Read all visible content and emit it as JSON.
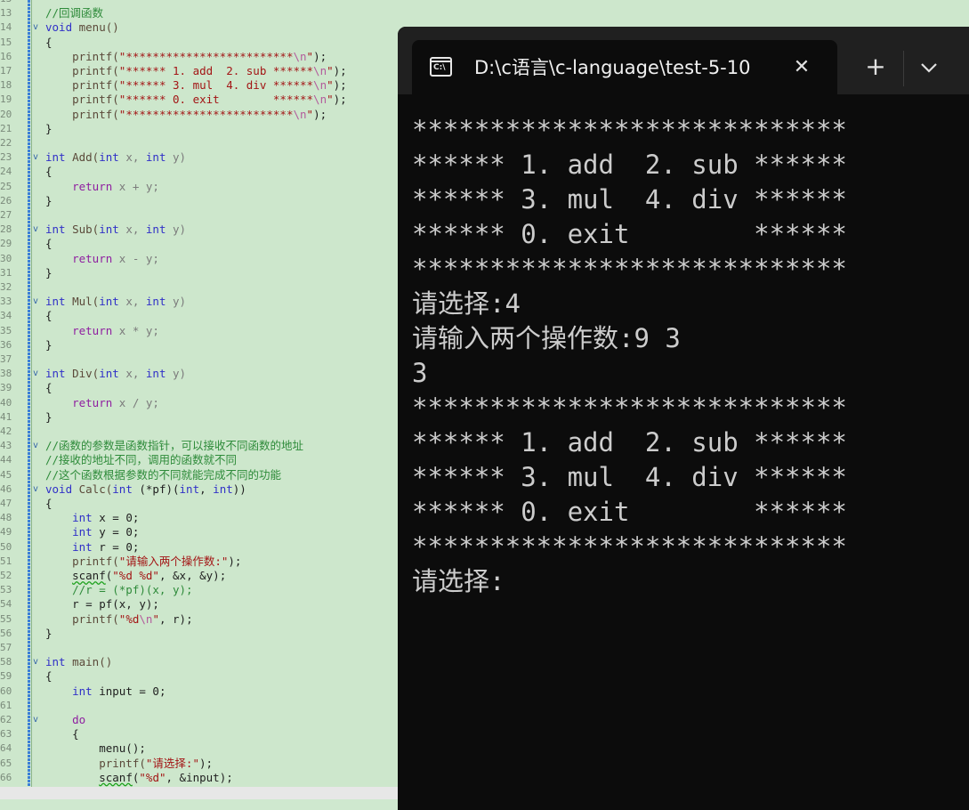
{
  "editor": {
    "lines": [
      {
        "n": "13",
        "fold": "",
        "tokens": [
          {
            "t": "",
            "c": "x"
          }
        ]
      },
      {
        "n": "13",
        "fold": "",
        "tokens": [
          {
            "t": "//回调函数",
            "c": "cm"
          }
        ]
      },
      {
        "n": "14",
        "fold": "v",
        "tokens": [
          {
            "t": "void",
            "c": "kw"
          },
          {
            "t": " menu()",
            "c": "fn"
          }
        ]
      },
      {
        "n": "15",
        "fold": "",
        "tokens": [
          {
            "t": "{",
            "c": "x"
          }
        ]
      },
      {
        "n": "16",
        "fold": "",
        "tokens": [
          {
            "t": "    printf(",
            "c": "fn"
          },
          {
            "t": "\"*************************",
            "c": "str"
          },
          {
            "t": "\\n",
            "c": "esc"
          },
          {
            "t": "\"",
            "c": "str"
          },
          {
            "t": ");",
            "c": "x"
          }
        ]
      },
      {
        "n": "17",
        "fold": "",
        "tokens": [
          {
            "t": "    printf(",
            "c": "fn"
          },
          {
            "t": "\"****** 1. add  2. sub ******",
            "c": "str"
          },
          {
            "t": "\\n",
            "c": "esc"
          },
          {
            "t": "\"",
            "c": "str"
          },
          {
            "t": ");",
            "c": "x"
          }
        ]
      },
      {
        "n": "18",
        "fold": "",
        "tokens": [
          {
            "t": "    printf(",
            "c": "fn"
          },
          {
            "t": "\"****** 3. mul  4. div ******",
            "c": "str"
          },
          {
            "t": "\\n",
            "c": "esc"
          },
          {
            "t": "\"",
            "c": "str"
          },
          {
            "t": ");",
            "c": "x"
          }
        ]
      },
      {
        "n": "19",
        "fold": "",
        "tokens": [
          {
            "t": "    printf(",
            "c": "fn"
          },
          {
            "t": "\"****** 0. exit        ******",
            "c": "str"
          },
          {
            "t": "\\n",
            "c": "esc"
          },
          {
            "t": "\"",
            "c": "str"
          },
          {
            "t": ");",
            "c": "x"
          }
        ]
      },
      {
        "n": "20",
        "fold": "",
        "tokens": [
          {
            "t": "    printf(",
            "c": "fn"
          },
          {
            "t": "\"*************************",
            "c": "str"
          },
          {
            "t": "\\n",
            "c": "esc"
          },
          {
            "t": "\"",
            "c": "str"
          },
          {
            "t": ");",
            "c": "x"
          }
        ]
      },
      {
        "n": "21",
        "fold": "",
        "tokens": [
          {
            "t": "}",
            "c": "x"
          }
        ]
      },
      {
        "n": "22",
        "fold": "",
        "tokens": []
      },
      {
        "n": "23",
        "fold": "v",
        "tokens": [
          {
            "t": "int",
            "c": "kw"
          },
          {
            "t": " Add(",
            "c": "fn"
          },
          {
            "t": "int",
            "c": "kw"
          },
          {
            "t": " x, ",
            "c": "id"
          },
          {
            "t": "int",
            "c": "kw"
          },
          {
            "t": " y)",
            "c": "id"
          }
        ]
      },
      {
        "n": "24",
        "fold": "",
        "tokens": [
          {
            "t": "{",
            "c": "x"
          }
        ]
      },
      {
        "n": "25",
        "fold": "",
        "tokens": [
          {
            "t": "    return",
            "c": "ctl"
          },
          {
            "t": " x + y;",
            "c": "id"
          }
        ]
      },
      {
        "n": "26",
        "fold": "",
        "tokens": [
          {
            "t": "}",
            "c": "x"
          }
        ]
      },
      {
        "n": "27",
        "fold": "",
        "tokens": []
      },
      {
        "n": "28",
        "fold": "v",
        "tokens": [
          {
            "t": "int",
            "c": "kw"
          },
          {
            "t": " Sub(",
            "c": "fn"
          },
          {
            "t": "int",
            "c": "kw"
          },
          {
            "t": " x, ",
            "c": "id"
          },
          {
            "t": "int",
            "c": "kw"
          },
          {
            "t": " y)",
            "c": "id"
          }
        ]
      },
      {
        "n": "29",
        "fold": "",
        "tokens": [
          {
            "t": "{",
            "c": "x"
          }
        ]
      },
      {
        "n": "30",
        "fold": "",
        "tokens": [
          {
            "t": "    return",
            "c": "ctl"
          },
          {
            "t": " x - y;",
            "c": "id"
          }
        ]
      },
      {
        "n": "31",
        "fold": "",
        "tokens": [
          {
            "t": "}",
            "c": "x"
          }
        ]
      },
      {
        "n": "32",
        "fold": "",
        "tokens": []
      },
      {
        "n": "33",
        "fold": "v",
        "tokens": [
          {
            "t": "int",
            "c": "kw"
          },
          {
            "t": " Mul(",
            "c": "fn"
          },
          {
            "t": "int",
            "c": "kw"
          },
          {
            "t": " x, ",
            "c": "id"
          },
          {
            "t": "int",
            "c": "kw"
          },
          {
            "t": " y)",
            "c": "id"
          }
        ]
      },
      {
        "n": "34",
        "fold": "",
        "tokens": [
          {
            "t": "{",
            "c": "x"
          }
        ]
      },
      {
        "n": "35",
        "fold": "",
        "tokens": [
          {
            "t": "    return",
            "c": "ctl"
          },
          {
            "t": " x * y;",
            "c": "id"
          }
        ]
      },
      {
        "n": "36",
        "fold": "",
        "tokens": [
          {
            "t": "}",
            "c": "x"
          }
        ]
      },
      {
        "n": "37",
        "fold": "",
        "tokens": []
      },
      {
        "n": "38",
        "fold": "v",
        "tokens": [
          {
            "t": "int",
            "c": "kw"
          },
          {
            "t": " Div(",
            "c": "fn"
          },
          {
            "t": "int",
            "c": "kw"
          },
          {
            "t": " x, ",
            "c": "id"
          },
          {
            "t": "int",
            "c": "kw"
          },
          {
            "t": " y)",
            "c": "id"
          }
        ]
      },
      {
        "n": "39",
        "fold": "",
        "tokens": [
          {
            "t": "{",
            "c": "x"
          }
        ]
      },
      {
        "n": "40",
        "fold": "",
        "tokens": [
          {
            "t": "    return",
            "c": "ctl"
          },
          {
            "t": " x / y;",
            "c": "id"
          }
        ]
      },
      {
        "n": "41",
        "fold": "",
        "tokens": [
          {
            "t": "}",
            "c": "x"
          }
        ]
      },
      {
        "n": "42",
        "fold": "",
        "tokens": []
      },
      {
        "n": "43",
        "fold": "v",
        "tokens": [
          {
            "t": "//函数的参数是函数指针，可以接收不同函数的地址",
            "c": "cm"
          }
        ]
      },
      {
        "n": "44",
        "fold": "",
        "tokens": [
          {
            "t": "//接收的地址不同，调用的函数就不同",
            "c": "cm"
          }
        ]
      },
      {
        "n": "45",
        "fold": "",
        "tokens": [
          {
            "t": "//这个函数根据参数的不同就能完成不同的功能",
            "c": "cm"
          }
        ]
      },
      {
        "n": "46",
        "fold": "v",
        "tokens": [
          {
            "t": "void",
            "c": "kw"
          },
          {
            "t": " Calc(",
            "c": "fn"
          },
          {
            "t": "int",
            "c": "kw"
          },
          {
            "t": " (*pf)(",
            "c": "x"
          },
          {
            "t": "int",
            "c": "kw"
          },
          {
            "t": ", ",
            "c": "x"
          },
          {
            "t": "int",
            "c": "kw"
          },
          {
            "t": "))",
            "c": "x"
          }
        ]
      },
      {
        "n": "47",
        "fold": "",
        "tokens": [
          {
            "t": "{",
            "c": "x"
          }
        ]
      },
      {
        "n": "48",
        "fold": "",
        "tokens": [
          {
            "t": "    ",
            "c": "x"
          },
          {
            "t": "int",
            "c": "kw"
          },
          {
            "t": " x = 0;",
            "c": "x"
          }
        ]
      },
      {
        "n": "49",
        "fold": "",
        "tokens": [
          {
            "t": "    ",
            "c": "x"
          },
          {
            "t": "int",
            "c": "kw"
          },
          {
            "t": " y = 0;",
            "c": "x"
          }
        ]
      },
      {
        "n": "50",
        "fold": "",
        "tokens": [
          {
            "t": "    ",
            "c": "x"
          },
          {
            "t": "int",
            "c": "kw"
          },
          {
            "t": " r = 0;",
            "c": "x"
          }
        ]
      },
      {
        "n": "51",
        "fold": "",
        "tokens": [
          {
            "t": "    printf(",
            "c": "fn"
          },
          {
            "t": "\"请输入两个操作数:\"",
            "c": "str"
          },
          {
            "t": ");",
            "c": "x"
          }
        ]
      },
      {
        "n": "52",
        "fold": "",
        "tokens": [
          {
            "t": "    ",
            "c": "x"
          },
          {
            "t": "scanf",
            "c": "sq"
          },
          {
            "t": "(",
            "c": "x"
          },
          {
            "t": "\"%d %d\"",
            "c": "str"
          },
          {
            "t": ", &x, &y);",
            "c": "x"
          }
        ]
      },
      {
        "n": "53",
        "fold": "",
        "tokens": [
          {
            "t": "    //r = (*pf)(x, y);",
            "c": "cm"
          }
        ]
      },
      {
        "n": "54",
        "fold": "",
        "tokens": [
          {
            "t": "    r = pf(x, y);",
            "c": "x"
          }
        ]
      },
      {
        "n": "55",
        "fold": "",
        "tokens": [
          {
            "t": "    printf(",
            "c": "fn"
          },
          {
            "t": "\"%d",
            "c": "str"
          },
          {
            "t": "\\n",
            "c": "esc"
          },
          {
            "t": "\"",
            "c": "str"
          },
          {
            "t": ", r);",
            "c": "x"
          }
        ]
      },
      {
        "n": "56",
        "fold": "",
        "tokens": [
          {
            "t": "}",
            "c": "x"
          }
        ]
      },
      {
        "n": "57",
        "fold": "",
        "tokens": []
      },
      {
        "n": "58",
        "fold": "v",
        "tokens": [
          {
            "t": "int",
            "c": "kw"
          },
          {
            "t": " main()",
            "c": "fn"
          }
        ]
      },
      {
        "n": "59",
        "fold": "",
        "tokens": [
          {
            "t": "{",
            "c": "x"
          }
        ]
      },
      {
        "n": "60",
        "fold": "",
        "tokens": [
          {
            "t": "    ",
            "c": "x"
          },
          {
            "t": "int",
            "c": "kw"
          },
          {
            "t": " input = 0;",
            "c": "x"
          }
        ]
      },
      {
        "n": "61",
        "fold": "",
        "tokens": []
      },
      {
        "n": "62",
        "fold": "v",
        "tokens": [
          {
            "t": "    do",
            "c": "ctl"
          }
        ]
      },
      {
        "n": "63",
        "fold": "",
        "tokens": [
          {
            "t": "    {",
            "c": "x"
          }
        ]
      },
      {
        "n": "64",
        "fold": "",
        "tokens": [
          {
            "t": "        menu();",
            "c": "x"
          }
        ]
      },
      {
        "n": "65",
        "fold": "",
        "tokens": [
          {
            "t": "        printf(",
            "c": "fn"
          },
          {
            "t": "\"请选择:\"",
            "c": "str"
          },
          {
            "t": ");",
            "c": "x"
          }
        ]
      },
      {
        "n": "66",
        "fold": "",
        "tokens": [
          {
            "t": "        ",
            "c": "x"
          },
          {
            "t": "scanf",
            "c": "sq"
          },
          {
            "t": "(",
            "c": "x"
          },
          {
            "t": "\"%d\"",
            "c": "str"
          },
          {
            "t": ", &input);",
            "c": "x"
          }
        ]
      }
    ]
  },
  "terminal": {
    "tab_title": "D:\\c语言\\c-language\\test-5-10",
    "icon_glyph": "C:\\",
    "close_glyph": "✕",
    "new_tab_glyph": "+",
    "output": [
      "****************************",
      "****** 1. add  2. sub ******",
      "****** 3. mul  4. div ******",
      "****** 0. exit        ******",
      "****************************",
      "请选择:4",
      "请输入两个操作数:9 3",
      "3",
      "****************************",
      "****** 1. add  2. sub ******",
      "****** 3. mul  4. div ******",
      "****** 0. exit        ******",
      "****************************",
      "请选择:"
    ]
  },
  "colors": {
    "editor_bg": "#cde7cc",
    "terminal_bg": "#0c0c0c",
    "titlebar_bg": "#202020",
    "terminal_text": "#cccccc"
  }
}
